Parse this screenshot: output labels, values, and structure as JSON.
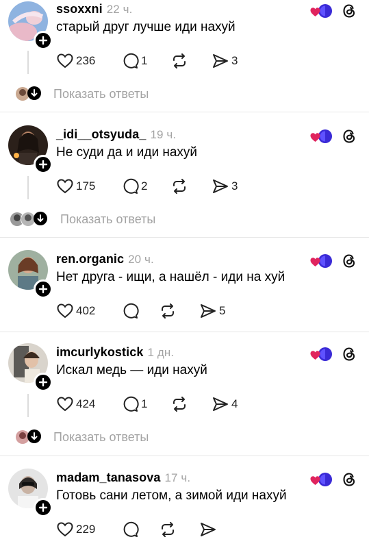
{
  "posts": [
    {
      "username": "ssoxxni",
      "time": "22 ч.",
      "text": "старый друг лучше иди нахуй",
      "likes": "236",
      "comments": "1",
      "reposts": "",
      "shares": "3",
      "show_replies": "Показать ответы"
    },
    {
      "username": "_idi__otsyuda_",
      "time": "19 ч.",
      "text": "Не суди да и иди нахуй",
      "likes": "175",
      "comments": "2",
      "reposts": "",
      "shares": "3",
      "show_replies": "Показать ответы"
    },
    {
      "username": "ren.organic",
      "time": "20 ч.",
      "text": "Нет друга - ищи, а нашёл - иди на хуй",
      "likes": "402",
      "comments": "",
      "reposts": "",
      "shares": "5"
    },
    {
      "username": "imcurlykostick",
      "time": "1 дн.",
      "text": "Искал медь — иди нахуй",
      "likes": "424",
      "comments": "1",
      "reposts": "",
      "shares": "4",
      "show_replies": "Показать ответы"
    },
    {
      "username": "madam_tanasova",
      "time": "17 ч.",
      "text": "Готовь сани летом, а зимой иди нахуй",
      "likes": "229",
      "comments": "",
      "reposts": "",
      "shares": ""
    }
  ],
  "icons": {
    "like": "heart-icon",
    "comment": "comment-icon",
    "repost": "repost-icon",
    "share": "share-icon",
    "badge": "heart-emoji-badge-icon",
    "threads": "threads-logo-icon",
    "follow": "plus-icon",
    "expand": "arrow-down-icon"
  },
  "colors": {
    "muted": "#a3a3a3",
    "badge_heart": "#e0245e",
    "badge_circle": "#3a2ad6"
  }
}
